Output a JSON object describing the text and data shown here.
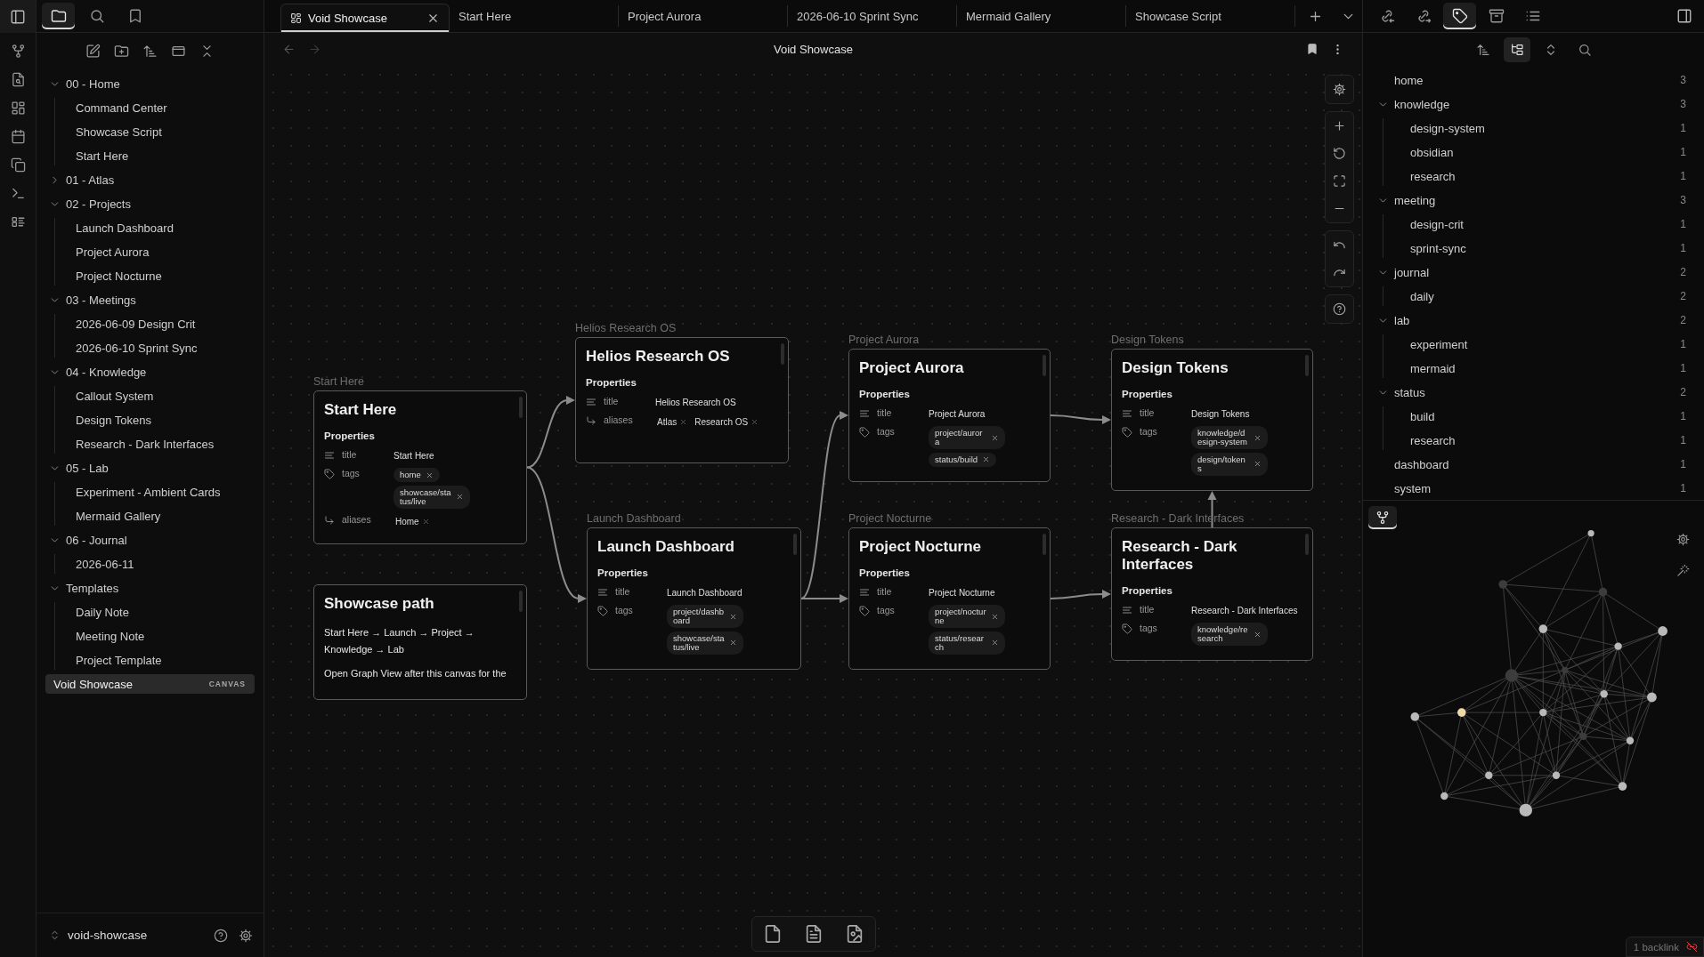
{
  "left_sidebar": {
    "tabs": [
      {
        "kind": "files",
        "selected": true
      },
      {
        "kind": "search",
        "selected": false
      },
      {
        "kind": "bookmarks",
        "selected": false
      }
    ],
    "tree": [
      {
        "kind": "folder",
        "label": "00 - Home",
        "expanded": true,
        "children": [
          {
            "kind": "file",
            "label": "Command Center",
            "selected": false
          },
          {
            "kind": "file",
            "label": "Showcase Script",
            "selected": false
          },
          {
            "kind": "file",
            "label": "Start Here",
            "selected": false
          }
        ]
      },
      {
        "kind": "folder",
        "label": "01 - Atlas",
        "expanded": false
      },
      {
        "kind": "folder",
        "label": "02 - Projects",
        "expanded": true,
        "children": [
          {
            "kind": "file",
            "label": "Launch Dashboard",
            "selected": false
          },
          {
            "kind": "file",
            "label": "Project Aurora",
            "selected": false
          },
          {
            "kind": "file",
            "label": "Project Nocturne",
            "selected": false
          }
        ]
      },
      {
        "kind": "folder",
        "label": "03 - Meetings",
        "expanded": true,
        "children": [
          {
            "kind": "file",
            "label": "2026-06-09 Design Crit",
            "selected": false
          },
          {
            "kind": "file",
            "label": "2026-06-10 Sprint Sync",
            "selected": false
          }
        ]
      },
      {
        "kind": "folder",
        "label": "04 - Knowledge",
        "expanded": true,
        "children": [
          {
            "kind": "file",
            "label": "Callout System",
            "selected": false
          },
          {
            "kind": "file",
            "label": "Design Tokens",
            "selected": false
          },
          {
            "kind": "file",
            "label": "Research - Dark Interfaces",
            "selected": false
          }
        ]
      },
      {
        "kind": "folder",
        "label": "05 - Lab",
        "expanded": true,
        "children": [
          {
            "kind": "file",
            "label": "Experiment - Ambient Cards",
            "selected": false
          },
          {
            "kind": "file",
            "label": "Mermaid Gallery",
            "selected": false
          }
        ]
      },
      {
        "kind": "folder",
        "label": "06 - Journal",
        "expanded": true,
        "children": [
          {
            "kind": "file",
            "label": "2026-06-11",
            "selected": false
          }
        ]
      },
      {
        "kind": "folder",
        "label": "Templates",
        "expanded": true,
        "children": [
          {
            "kind": "file",
            "label": "Daily Note",
            "selected": false
          },
          {
            "kind": "file",
            "label": "Meeting Note",
            "selected": false
          },
          {
            "kind": "file",
            "label": "Project Template",
            "selected": false
          }
        ]
      },
      {
        "kind": "file",
        "label": "Void Showcase",
        "badge": "CANVAS",
        "selected": true
      }
    ],
    "vault": "void-showcase"
  },
  "tabs": [
    {
      "label": "Void Showcase",
      "selected": true
    },
    {
      "label": "Start Here",
      "selected": false
    },
    {
      "label": "Project Aurora",
      "selected": false
    },
    {
      "label": "2026-06-10 Sprint Sync",
      "selected": false
    },
    {
      "label": "Mermaid Gallery",
      "selected": false
    },
    {
      "label": "Showcase Script",
      "selected": false
    }
  ],
  "view": {
    "title": "Void Showcase"
  },
  "canvas": {
    "nodes": [
      {
        "kind": "note",
        "label": "Start Here",
        "title": "Start Here",
        "properties_heading": "Properties",
        "properties": [
          {
            "kind": "text",
            "name": "title",
            "value": "Start Here"
          },
          {
            "kind": "tags",
            "name": "tags",
            "values": [
              "home",
              "showcase/status/live"
            ]
          },
          {
            "kind": "aliases",
            "name": "aliases",
            "values": [
              "Home"
            ]
          }
        ]
      },
      {
        "kind": "text",
        "title": "Showcase path",
        "paragraphs": [
          "Start Here → Launch → Project → Knowledge → Lab",
          "Open Graph View after this canvas for the"
        ]
      },
      {
        "kind": "note",
        "label": "Helios Research OS",
        "title": "Helios Research OS",
        "properties_heading": "Properties",
        "properties": [
          {
            "kind": "text",
            "name": "title",
            "value": "Helios Research OS"
          },
          {
            "kind": "aliases",
            "name": "aliases",
            "values": [
              "Atlas",
              "Research OS"
            ]
          }
        ]
      },
      {
        "kind": "note",
        "label": "Launch Dashboard",
        "title": "Launch Dashboard",
        "properties_heading": "Properties",
        "properties": [
          {
            "kind": "text",
            "name": "title",
            "value": "Launch Dashboard"
          },
          {
            "kind": "tags",
            "name": "tags",
            "values": [
              "project/dashboard",
              "showcase/status/live"
            ]
          }
        ]
      },
      {
        "kind": "note",
        "label": "Project Aurora",
        "title": "Project Aurora",
        "properties_heading": "Properties",
        "properties": [
          {
            "kind": "text",
            "name": "title",
            "value": "Project Aurora"
          },
          {
            "kind": "tags",
            "name": "tags",
            "values": [
              "project/aurora",
              "status/build"
            ]
          }
        ]
      },
      {
        "kind": "note",
        "label": "Project Nocturne",
        "title": "Project Nocturne",
        "properties_heading": "Properties",
        "properties": [
          {
            "kind": "text",
            "name": "title",
            "value": "Project Nocturne"
          },
          {
            "kind": "tags",
            "name": "tags",
            "values": [
              "project/nocturne",
              "status/research"
            ]
          }
        ]
      },
      {
        "kind": "note",
        "label": "Design Tokens",
        "title": "Design Tokens",
        "properties_heading": "Properties",
        "properties": [
          {
            "kind": "text",
            "name": "title",
            "value": "Design Tokens"
          },
          {
            "kind": "tags",
            "name": "tags",
            "values": [
              "knowledge/design-system",
              "design/tokens"
            ]
          }
        ]
      },
      {
        "kind": "note",
        "label": "Research - Dark Interfaces",
        "title": "Research - Dark Interfaces",
        "properties_heading": "Properties",
        "properties": [
          {
            "kind": "text",
            "name": "title",
            "value": "Research - Dark Interfaces"
          },
          {
            "kind": "tags",
            "name": "tags",
            "values": [
              "knowledge/research"
            ]
          }
        ]
      }
    ]
  },
  "right_sidebar": {
    "tabs": [
      {
        "kind": "backlinks",
        "selected": false
      },
      {
        "kind": "outgoing",
        "selected": false
      },
      {
        "kind": "tags",
        "selected": true
      },
      {
        "kind": "archive",
        "selected": false
      },
      {
        "kind": "outline",
        "selected": false
      }
    ],
    "toolbar": [
      {
        "kind": "sort",
        "selected": false
      },
      {
        "kind": "nested",
        "selected": true
      },
      {
        "kind": "expand",
        "selected": false
      },
      {
        "kind": "search",
        "selected": false
      }
    ],
    "tags": [
      {
        "label": "home",
        "count": "3"
      },
      {
        "label": "knowledge",
        "count": "3",
        "expanded": true,
        "children": [
          {
            "label": "design-system",
            "count": "1"
          },
          {
            "label": "obsidian",
            "count": "1"
          },
          {
            "label": "research",
            "count": "1"
          }
        ]
      },
      {
        "label": "meeting",
        "count": "3",
        "expanded": true,
        "children": [
          {
            "label": "design-crit",
            "count": "1"
          },
          {
            "label": "sprint-sync",
            "count": "1"
          }
        ]
      },
      {
        "label": "journal",
        "count": "2",
        "expanded": true,
        "children": [
          {
            "label": "daily",
            "count": "2"
          }
        ]
      },
      {
        "label": "lab",
        "count": "2",
        "expanded": true,
        "children": [
          {
            "label": "experiment",
            "count": "1"
          },
          {
            "label": "mermaid",
            "count": "1"
          }
        ]
      },
      {
        "label": "status",
        "count": "2",
        "expanded": true,
        "children": [
          {
            "label": "build",
            "count": "1"
          },
          {
            "label": "research",
            "count": "1"
          }
        ]
      },
      {
        "label": "dashboard",
        "count": "1"
      },
      {
        "label": "system",
        "count": "1"
      }
    ],
    "graph_tabs": [
      {
        "kind": "graph",
        "selected": true
      }
    ]
  },
  "status_bar": {
    "backlinks": "1 backlink"
  }
}
